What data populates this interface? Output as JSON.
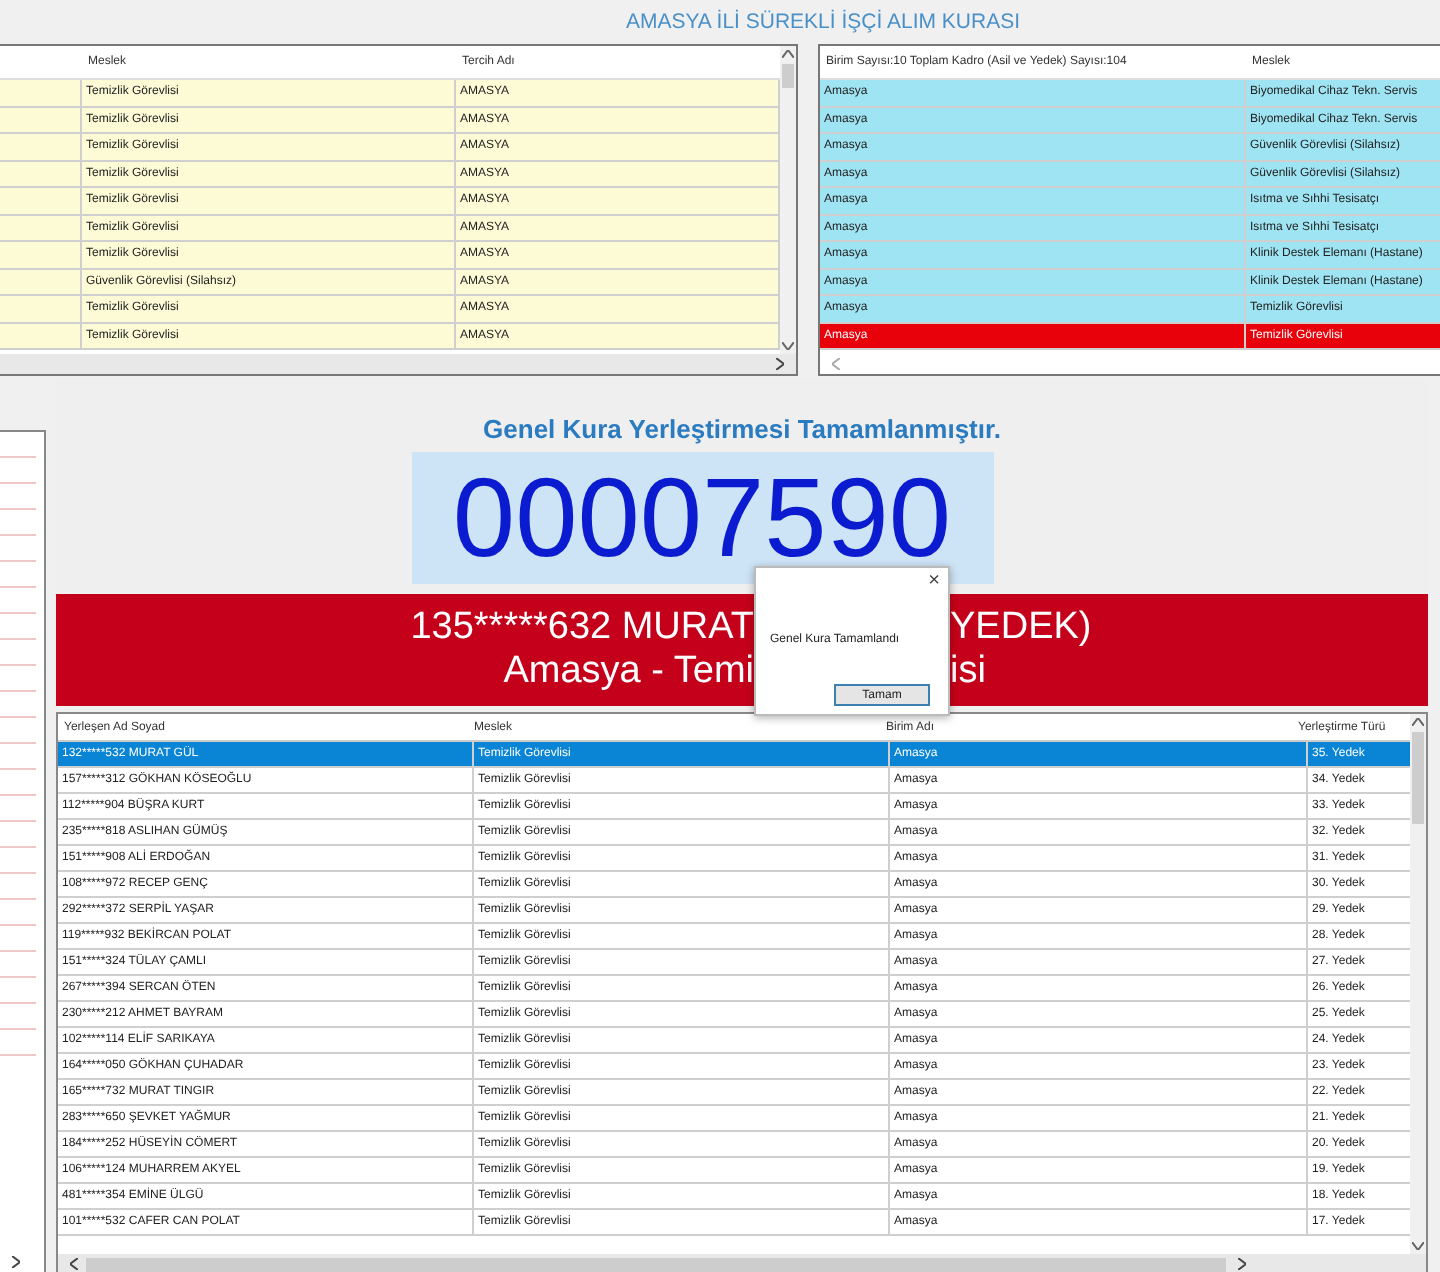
{
  "title": "AMASYA İLİ SÜREKLİ İŞÇİ ALIM KURASI",
  "preference_grid": {
    "columns": [
      "Meslek",
      "Tercih Adı"
    ],
    "rows": [
      {
        "meslek": "Temizlik Görevlisi",
        "tercih": "AMASYA"
      },
      {
        "meslek": "Temizlik Görevlisi",
        "tercih": "AMASYA"
      },
      {
        "meslek": "Temizlik Görevlisi",
        "tercih": "AMASYA"
      },
      {
        "meslek": "Temizlik Görevlisi",
        "tercih": "AMASYA"
      },
      {
        "meslek": "Temizlik Görevlisi",
        "tercih": "AMASYA"
      },
      {
        "meslek": "Temizlik Görevlisi",
        "tercih": "AMASYA"
      },
      {
        "meslek": "Temizlik Görevlisi",
        "tercih": "AMASYA"
      },
      {
        "meslek": "Güvenlik Görevlisi (Silahsız)",
        "tercih": "AMASYA"
      },
      {
        "meslek": "Temizlik Görevlisi",
        "tercih": "AMASYA"
      },
      {
        "meslek": "Temizlik Görevlisi",
        "tercih": "AMASYA"
      }
    ]
  },
  "unit_grid": {
    "columns": [
      "Birim Sayısı:10 Toplam Kadro (Asil ve Yedek) Sayısı:104",
      "Meslek"
    ],
    "rows": [
      {
        "birim": "Amasya",
        "meslek": "Biyomedikal Cihaz Tekn. Servis",
        "selected": false
      },
      {
        "birim": "Amasya",
        "meslek": "Biyomedikal Cihaz Tekn. Servis",
        "selected": false
      },
      {
        "birim": "Amasya",
        "meslek": "Güvenlik Görevlisi (Silahsız)",
        "selected": false
      },
      {
        "birim": "Amasya",
        "meslek": "Güvenlik Görevlisi (Silahsız)",
        "selected": false
      },
      {
        "birim": "Amasya",
        "meslek": "Isıtma ve Sıhhi Tesisatçı",
        "selected": false
      },
      {
        "birim": "Amasya",
        "meslek": "Isıtma ve Sıhhi Tesisatçı",
        "selected": false
      },
      {
        "birim": "Amasya",
        "meslek": "Klinik Destek Elemanı (Hastane)",
        "selected": false
      },
      {
        "birim": "Amasya",
        "meslek": "Klinik Destek Elemanı (Hastane)",
        "selected": false
      },
      {
        "birim": "Amasya",
        "meslek": "Temizlik Görevlisi",
        "selected": false
      },
      {
        "birim": "Amasya",
        "meslek": "Temizlik Görevlisi",
        "selected": true
      }
    ]
  },
  "heading": "Genel Kura Yerleştirmesi Tamamlanmıştır.",
  "draw_number": "00007590",
  "banner": {
    "line_1_left": "135*****632 MURAT",
    "line_1_right": "YEDEK)",
    "line_2_left": "Amasya - Temi",
    "line_2_right": "isi"
  },
  "dialog": {
    "close": "×",
    "message": "Genel Kura Tamamlandı",
    "button": "Tamam"
  },
  "result_grid": {
    "columns": [
      "Yerleşen Ad Soyad",
      "Meslek",
      "Birim Adı",
      "Yerleştirme Türü"
    ],
    "rows": [
      {
        "name": "132*****532 MURAT GÜL",
        "meslek": "Temizlik Görevlisi",
        "birim": "Amasya",
        "tur": "35. Yedek",
        "selected": true
      },
      {
        "name": "157*****312 GÖKHAN KÖSEOĞLU",
        "meslek": "Temizlik Görevlisi",
        "birim": "Amasya",
        "tur": "34. Yedek",
        "selected": false
      },
      {
        "name": "112*****904 BÜŞRA KURT",
        "meslek": "Temizlik Görevlisi",
        "birim": "Amasya",
        "tur": "33. Yedek",
        "selected": false
      },
      {
        "name": "235*****818 ASLIHAN GÜMÜŞ",
        "meslek": "Temizlik Görevlisi",
        "birim": "Amasya",
        "tur": "32. Yedek",
        "selected": false
      },
      {
        "name": "151*****908 ALİ ERDOĞAN",
        "meslek": "Temizlik Görevlisi",
        "birim": "Amasya",
        "tur": "31. Yedek",
        "selected": false
      },
      {
        "name": "108*****972 RECEP GENÇ",
        "meslek": "Temizlik Görevlisi",
        "birim": "Amasya",
        "tur": "30. Yedek",
        "selected": false
      },
      {
        "name": "292*****372 SERPİL YAŞAR",
        "meslek": "Temizlik Görevlisi",
        "birim": "Amasya",
        "tur": "29. Yedek",
        "selected": false
      },
      {
        "name": "119*****932 BEKİRCAN POLAT",
        "meslek": "Temizlik Görevlisi",
        "birim": "Amasya",
        "tur": "28. Yedek",
        "selected": false
      },
      {
        "name": "151*****324 TÜLAY ÇAMLI",
        "meslek": "Temizlik Görevlisi",
        "birim": "Amasya",
        "tur": "27. Yedek",
        "selected": false
      },
      {
        "name": "267*****394 SERCAN ÖTEN",
        "meslek": "Temizlik Görevlisi",
        "birim": "Amasya",
        "tur": "26. Yedek",
        "selected": false
      },
      {
        "name": "230*****212 AHMET BAYRAM",
        "meslek": "Temizlik Görevlisi",
        "birim": "Amasya",
        "tur": "25. Yedek",
        "selected": false
      },
      {
        "name": "102*****114 ELİF SARIKAYA",
        "meslek": "Temizlik Görevlisi",
        "birim": "Amasya",
        "tur": "24. Yedek",
        "selected": false
      },
      {
        "name": "164*****050 GÖKHAN ÇUHADAR",
        "meslek": "Temizlik Görevlisi",
        "birim": "Amasya",
        "tur": "23. Yedek",
        "selected": false
      },
      {
        "name": "165*****732 MURAT TINGIR",
        "meslek": "Temizlik Görevlisi",
        "birim": "Amasya",
        "tur": "22. Yedek",
        "selected": false
      },
      {
        "name": "283*****650 ŞEVKET YAĞMUR",
        "meslek": "Temizlik Görevlisi",
        "birim": "Amasya",
        "tur": "21. Yedek",
        "selected": false
      },
      {
        "name": "184*****252 HÜSEYİN CÖMERT",
        "meslek": "Temizlik Görevlisi",
        "birim": "Amasya",
        "tur": "20. Yedek",
        "selected": false
      },
      {
        "name": "106*****124 MUHARREM AKYEL",
        "meslek": "Temizlik Görevlisi",
        "birim": "Amasya",
        "tur": "19. Yedek",
        "selected": false
      },
      {
        "name": "481*****354 EMİNE ÜLGÜ",
        "meslek": "Temizlik Görevlisi",
        "birim": "Amasya",
        "tur": "18. Yedek",
        "selected": false
      },
      {
        "name": "101*****532 CAFER CAN POLAT",
        "meslek": "Temizlik Görevlisi",
        "birim": "Amasya",
        "tur": "17. Yedek",
        "selected": false
      }
    ]
  }
}
